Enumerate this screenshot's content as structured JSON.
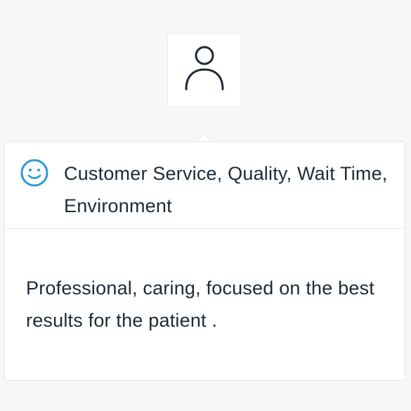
{
  "avatar": {
    "icon": "user-icon"
  },
  "review": {
    "icon": "smile-icon",
    "icon_color": "#2c9ad6",
    "categories": "Customer Service, Quality, Wait Time, Environment",
    "comment": "Professional, caring, focused on the best results for the patient ."
  },
  "colors": {
    "background": "#f7f7f7",
    "card": "#ffffff",
    "text": "#1f2a36",
    "border": "#e6e6e6"
  }
}
